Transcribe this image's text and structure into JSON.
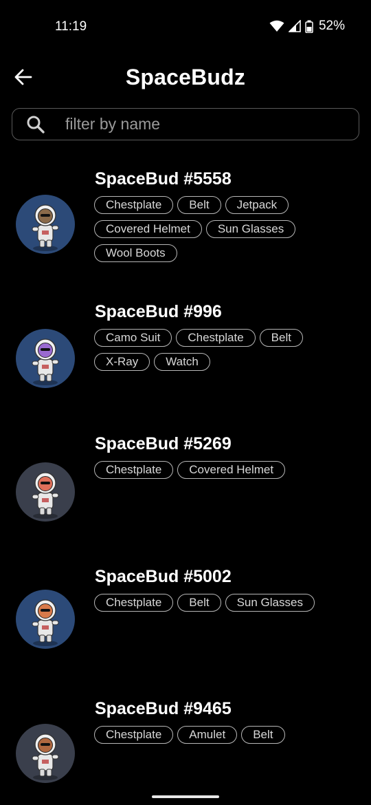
{
  "status": {
    "time": "11:19",
    "battery": "52%"
  },
  "header": {
    "title": "SpaceBudz",
    "back_icon": "arrow-left-icon"
  },
  "search": {
    "placeholder": "filter by name",
    "value": "",
    "icon": "search-icon"
  },
  "items": [
    {
      "name": "SpaceBud #5558",
      "tags": [
        "Chestplate",
        "Belt",
        "Jetpack",
        "Covered Helmet",
        "Sun Glasses",
        "Wool Boots"
      ],
      "avatar_bg": "#2c4a78",
      "character": "#8a6a4a"
    },
    {
      "name": "SpaceBud #996",
      "tags": [
        "Camo Suit",
        "Chestplate",
        "Belt",
        "X-Ray",
        "Watch"
      ],
      "avatar_bg": "#2c4a78",
      "character": "#9a6ad0"
    },
    {
      "name": "SpaceBud #5269",
      "tags": [
        "Chestplate",
        "Covered Helmet"
      ],
      "avatar_bg": "#3a3f4c",
      "character": "#e0705a"
    },
    {
      "name": "SpaceBud #5002",
      "tags": [
        "Chestplate",
        "Belt",
        "Sun Glasses"
      ],
      "avatar_bg": "#2c4a78",
      "character": "#d87a4a"
    },
    {
      "name": "SpaceBud #9465",
      "tags": [
        "Chestplate",
        "Amulet",
        "Belt"
      ],
      "avatar_bg": "#3a3f4c",
      "character": "#b06840"
    }
  ]
}
